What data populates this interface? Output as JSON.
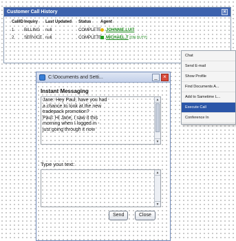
{
  "history": {
    "title": "Customer Call History",
    "close_glyph": "×",
    "headers": {
      "id": "CallID",
      "inquiry": "Inquiry",
      "updated": "Last Updated",
      "status": "Status",
      "agent": "Agent"
    },
    "rows": [
      {
        "id": "1",
        "inquiry": "BILLING",
        "updated": "null",
        "status": "COMPLETE",
        "agent": "JOHNNIE.LUI7",
        "presence": "yellow",
        "extra": ""
      },
      {
        "id": "2",
        "inquiry": "SERVICE",
        "updated": "null",
        "status": "COMPLETE",
        "agent": "MICHAEL.T",
        "presence": "green",
        "extra": "[ON DUTY]"
      }
    ]
  },
  "context_menu": {
    "items": [
      {
        "label": "Chat",
        "highlighted": false
      },
      {
        "label": "Send E-mail",
        "highlighted": false
      },
      {
        "label": "Show Profile",
        "highlighted": false
      },
      {
        "label": "Find Documents A...",
        "highlighted": false
      },
      {
        "label": "Add to Sametime L...",
        "highlighted": false
      },
      {
        "label": "Execute Call",
        "highlighted": true
      },
      {
        "label": "Conference In",
        "highlighted": false
      }
    ]
  },
  "im_window": {
    "title": "C:\\Documents and Setti...",
    "minimize_glyph": "_",
    "close_glyph": "×",
    "heading": "Instant Messaging",
    "transcript_lines": [
      "Jane: Hey Paul, have you had",
      "a chance to look at the new",
      "tradepack promotion?",
      "Paul: Hi Jane, I saw it this",
      "morning when I logged in -",
      "just going through it now"
    ],
    "input_label": "Type your text:",
    "input_value": "",
    "send_label": "Send",
    "close_label": "Close",
    "scroll_up": "▲",
    "scroll_down": "▼"
  }
}
